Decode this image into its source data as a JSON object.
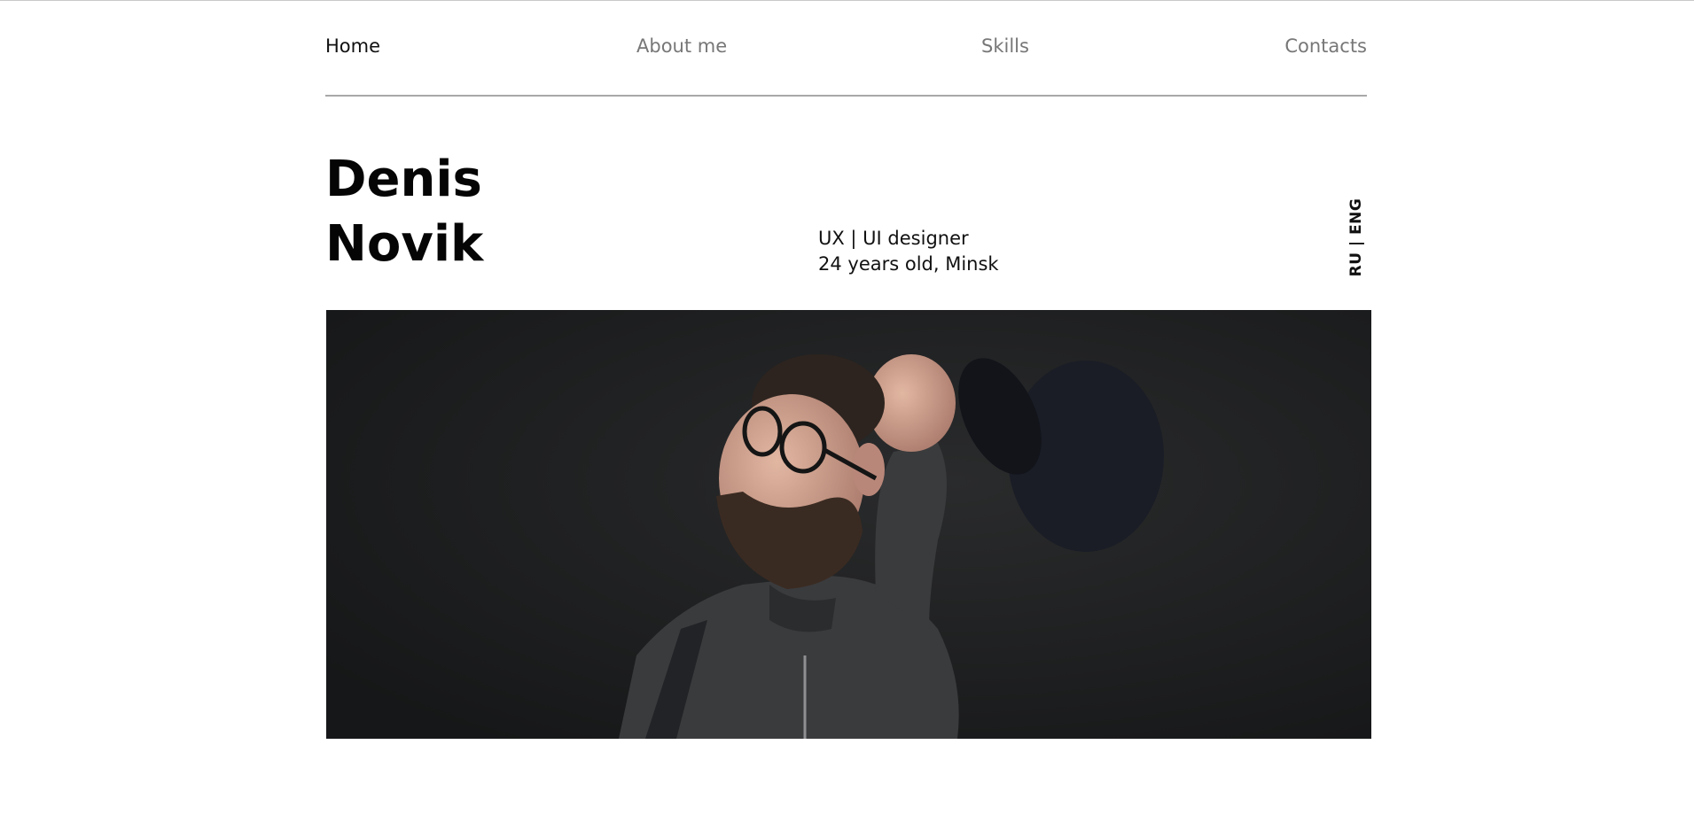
{
  "nav": {
    "items": [
      {
        "label": "Home",
        "active": true
      },
      {
        "label": "About me",
        "active": false
      },
      {
        "label": "Skills",
        "active": false
      },
      {
        "label": "Contacts",
        "active": false
      }
    ]
  },
  "profile": {
    "first_name": "Denis",
    "last_name": "Novik",
    "role": "UX | UI designer",
    "details": "24 years old, Minsk"
  },
  "language_switch": {
    "label": "RU | ENG"
  },
  "hero": {
    "icon": "portrait-photo",
    "colors": {
      "background": "#1c1d1e",
      "hoodie": "#3a3b3d",
      "cap": "#1a1d26",
      "skin": "#c99a85",
      "beard": "#3a2b22"
    }
  }
}
